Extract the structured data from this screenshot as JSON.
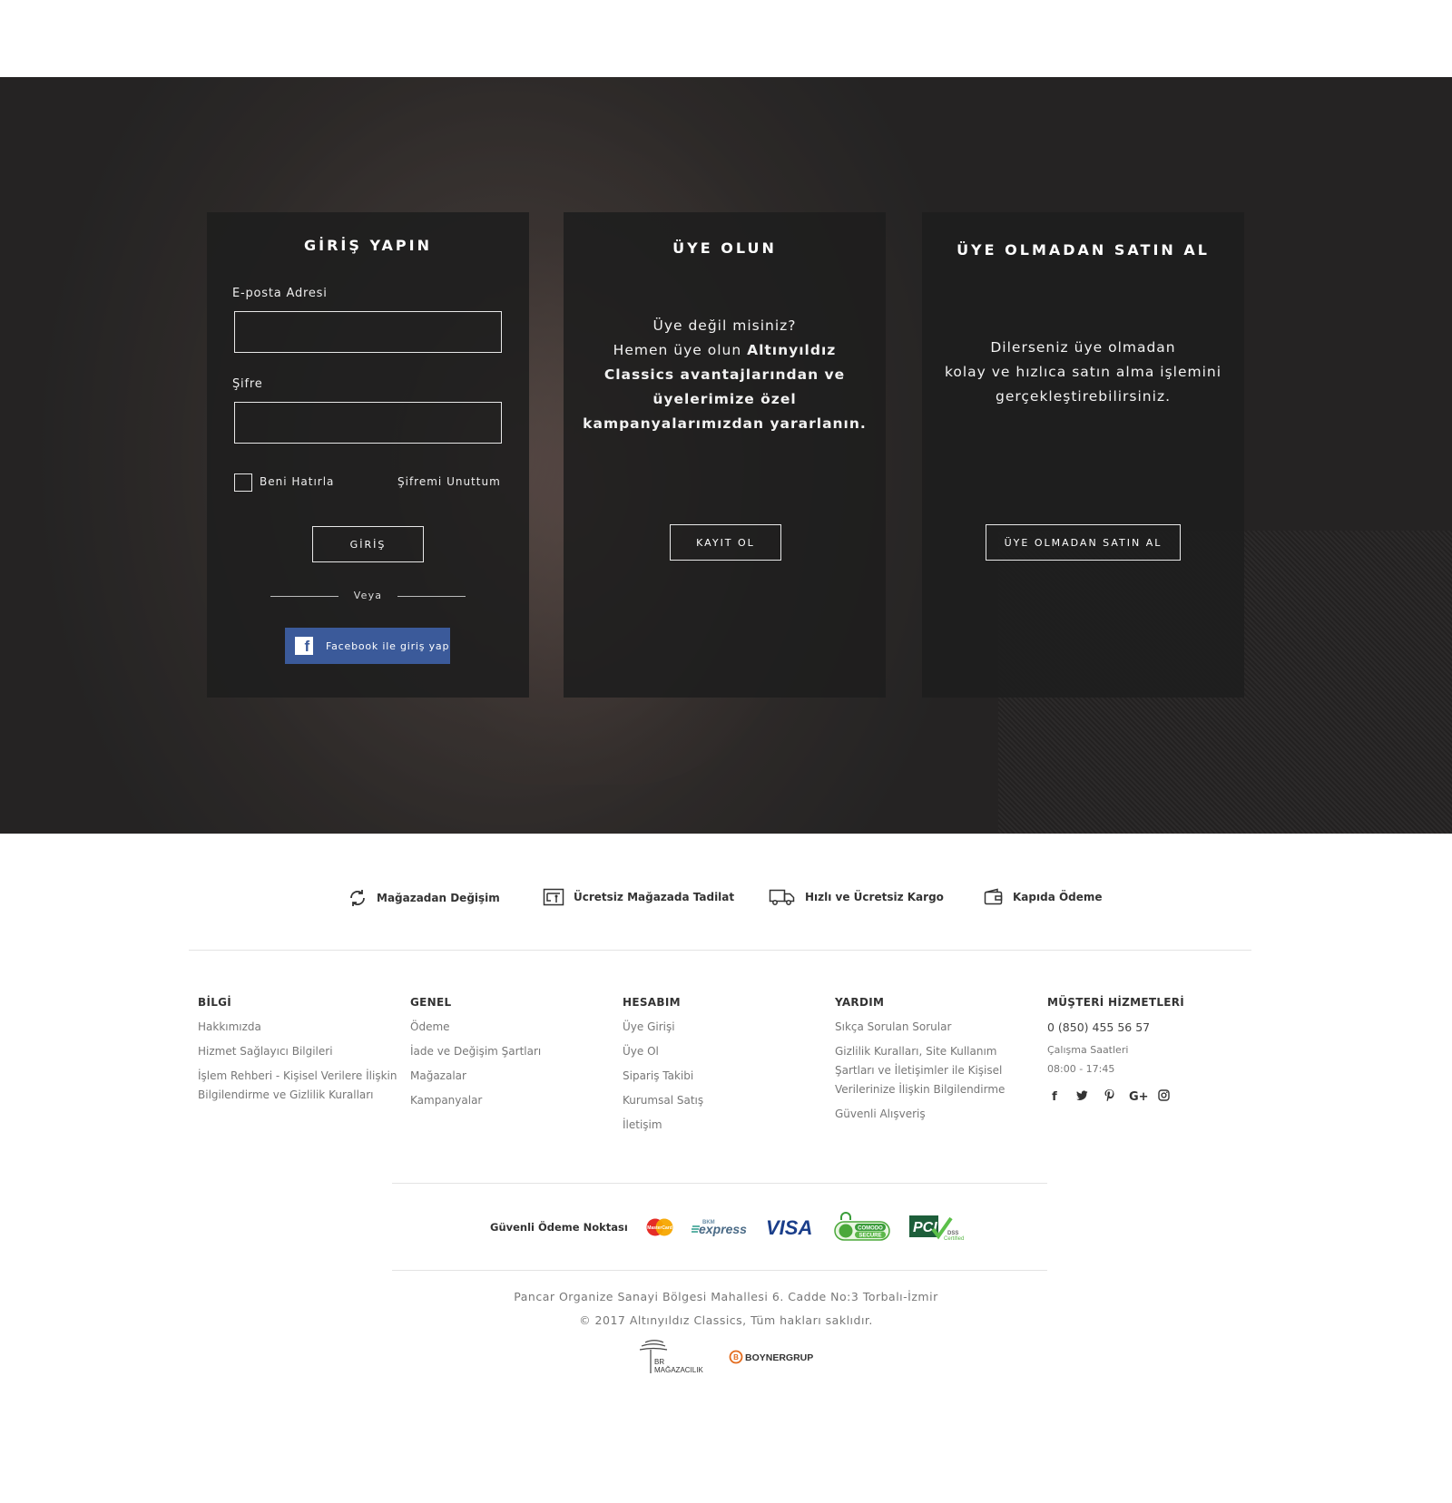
{
  "login": {
    "title": "GİRİŞ YAPIN",
    "email_label": "E-posta Adresi",
    "email_value": "",
    "password_label": "Şifre",
    "password_value": "",
    "remember_label": "Beni Hatırla",
    "remember_checked": false,
    "forgot_label": "Şifremi Unuttum",
    "submit_label": "GİRİŞ",
    "or_label": "Veya",
    "facebook_label": "Facebook ile giriş yap"
  },
  "register": {
    "title": "ÜYE OLUN",
    "line1": "Üye değil misiniz?",
    "line2_prefix": "Hemen üye olun ",
    "line2_bold": "Altınyıldız",
    "line3": "Classics avantajlarından ve",
    "line4": "üyelerimize özel",
    "line5": "kampanyalarımızdan yararlanın.",
    "button_label": "KAYIT OL"
  },
  "guest": {
    "title": "ÜYE OLMADAN SATIN AL",
    "line1": "Dilerseniz üye olmadan",
    "line2": "kolay ve hızlıca satın alma işlemini",
    "line3": "gerçekleştirebilirsiniz.",
    "button_label": "ÜYE OLMADAN SATIN AL"
  },
  "features": [
    {
      "label": "Mağazadan Değişim",
      "icon": "exchange-icon"
    },
    {
      "label": "Ücretsiz Mağazada Tadilat",
      "icon": "sewing-machine-icon"
    },
    {
      "label": "Hızlı ve Ücretsiz Kargo",
      "icon": "truck-icon"
    },
    {
      "label": "Kapıda Ödeme",
      "icon": "wallet-icon"
    }
  ],
  "footer": {
    "bilgi": {
      "title": "BİLGİ",
      "links": [
        "Hakkımızda",
        "Hizmet Sağlayıcı Bilgileri",
        "İşlem Rehberi - Kişisel Verilere İlişkin Bilgilendirme ve Gizlilik Kuralları"
      ]
    },
    "genel": {
      "title": "GENEL",
      "links": [
        "Ödeme",
        "İade ve Değişim Şartları",
        "Mağazalar",
        "Kampanyalar"
      ]
    },
    "hesabim": {
      "title": "HESABIM",
      "links": [
        "Üye Girişi",
        "Üye Ol",
        "Sipariş Takibi",
        "Kurumsal Satış",
        "İletişim"
      ]
    },
    "yardim": {
      "title": "YARDIM",
      "links": [
        "Sıkça Sorulan Sorular",
        "Gizlilik Kuralları, Site Kullanım Şartları ve İletişimler ile Kişisel Verilerinize İlişkin Bilgilendirme",
        "Güvenli Alışveriş"
      ]
    },
    "musteri": {
      "title": "MÜŞTERİ HİZMETLERİ",
      "phone": "0 (850) 455 56 57",
      "hours_label": "Çalışma Saatleri",
      "hours": "08:00 - 17:45"
    },
    "social": [
      "f",
      "t",
      "p",
      "G+",
      "ig"
    ]
  },
  "payment": {
    "label": "Güvenli Ödeme Noktası",
    "mastercard": "MasterCard",
    "express": "express",
    "express_top": "BKM",
    "visa": "VISA",
    "comodo_top": "COMODO",
    "comodo_bottom": "SECURE",
    "pci": "PCI",
    "pci_sub1": "DSS",
    "pci_sub2": "Certified"
  },
  "address": "Pancar Organize Sanayi Bölgesi Mahallesi 6. Cadde No:3 Torbalı-İzmir",
  "copyright": "© 2017 Altınyıldız Classics, Tüm hakları saklıdır.",
  "brands": {
    "br_line1": "BR",
    "br_line2": "MAĞAZACILIK",
    "boyner": "BOYNERGRUP"
  }
}
